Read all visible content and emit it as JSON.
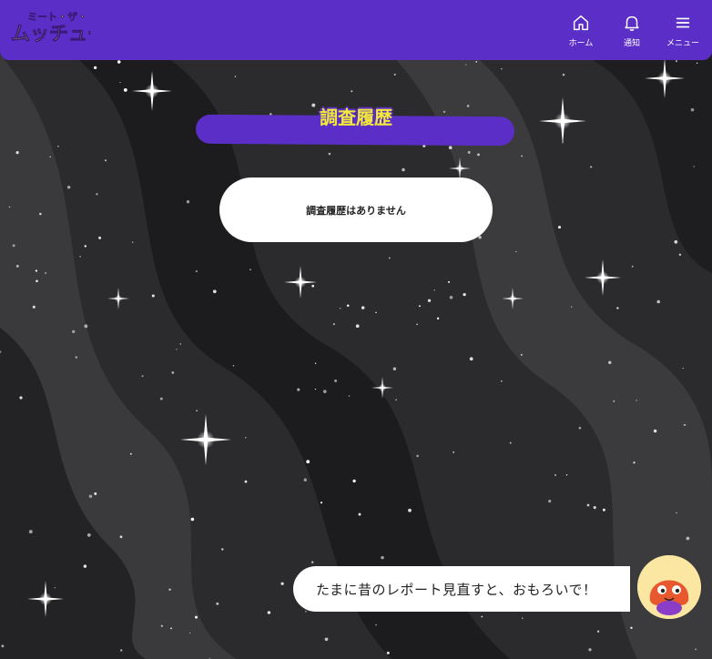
{
  "header": {
    "logo_alt": "ミート・ザ・ムッチュー人",
    "nav": [
      {
        "label": "ホーム",
        "icon": "home-icon"
      },
      {
        "label": "通知",
        "icon": "bell-icon"
      },
      {
        "label": "メニュー",
        "icon": "menu-icon"
      }
    ]
  },
  "main": {
    "title": "調査履歴",
    "empty_message": "調査履歴はありません"
  },
  "assistant": {
    "message": "たまに昔のレポート見直すと、おもろいで！",
    "avatar": "octopus-mascot-icon"
  },
  "colors": {
    "brand_purple": "#5b2fc7",
    "title_yellow": "#f2e93a",
    "background": "#2a2a2c"
  }
}
